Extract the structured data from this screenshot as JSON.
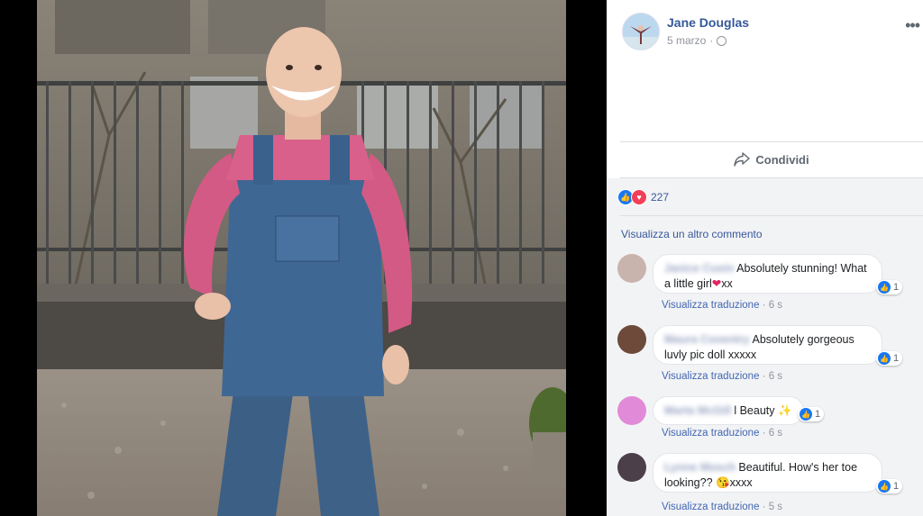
{
  "post": {
    "author": "Jane Douglas",
    "date": "5 marzo",
    "date_sep": "·",
    "more_icon": "more-options-icon",
    "share_label": "Condividi",
    "reactions_count": "227",
    "view_more": "Visualizza un altro commento"
  },
  "comments": [
    {
      "name": "Janice Cusin",
      "text": "Absolutely stunning! What a little girl",
      "emoji": "❤",
      "suffix": "xx",
      "translate": "Visualizza traduzione",
      "time": "6 s",
      "likes": "1",
      "avatar_color": "#c9b3ad"
    },
    {
      "name": "Maura Coventry",
      "text": "Absolutely gorgeous luvly pic doll xxxxx",
      "translate": "Visualizza traduzione",
      "time": "6 s",
      "likes": "1",
      "avatar_color": "#6e4a3a"
    },
    {
      "name": "Marta McGill",
      "text": "l Beauty",
      "emoji": "✨",
      "translate": "Visualizza traduzione",
      "time": "6 s",
      "likes": "1",
      "avatar_color": "#e08ad8"
    },
    {
      "name": "Lynne Mosch",
      "text": "Beautiful. How's her toe looking??",
      "emoji": "😘",
      "suffix": "xxxx",
      "translate": "Visualizza traduzione",
      "time": "5 s",
      "likes": "1",
      "avatar_color": "#4b3f4a"
    }
  ]
}
